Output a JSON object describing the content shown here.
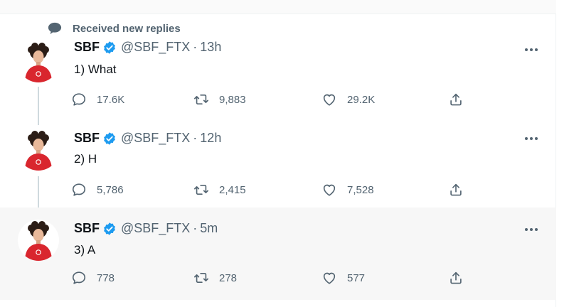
{
  "context": {
    "label": "Received new replies",
    "icon": "speech-bubble-icon"
  },
  "colors": {
    "verified": "#1d9bf0",
    "muted": "#536471",
    "thread_line": "#cfd9de",
    "shirt": "#d9262e"
  },
  "tweets": [
    {
      "name": "SBF",
      "handle": "@SBF_FTX",
      "sep": "·",
      "time": "13h",
      "text": "1) What",
      "replies": "17.6K",
      "retweets": "9,883",
      "likes": "29.2K"
    },
    {
      "name": "SBF",
      "handle": "@SBF_FTX",
      "sep": "·",
      "time": "12h",
      "text": "2) H",
      "replies": "5,786",
      "retweets": "2,415",
      "likes": "7,528"
    },
    {
      "name": "SBF",
      "handle": "@SBF_FTX",
      "sep": "·",
      "time": "5m",
      "text": "3) A",
      "replies": "778",
      "retweets": "278",
      "likes": "577"
    }
  ]
}
